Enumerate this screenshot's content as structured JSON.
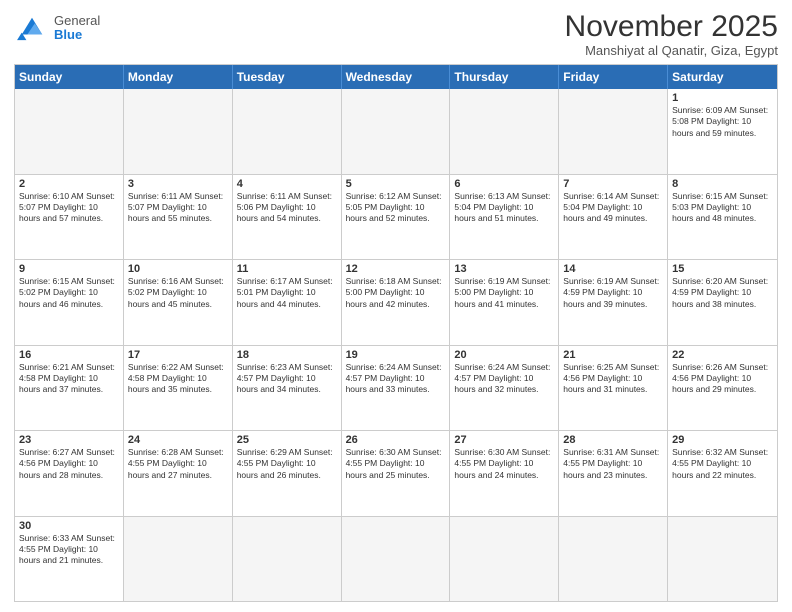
{
  "header": {
    "logo": {
      "general": "General",
      "blue": "Blue"
    },
    "month_title": "November 2025",
    "location": "Manshiyat al Qanatir, Giza, Egypt"
  },
  "weekdays": [
    "Sunday",
    "Monday",
    "Tuesday",
    "Wednesday",
    "Thursday",
    "Friday",
    "Saturday"
  ],
  "weeks": [
    [
      {
        "day": "",
        "info": ""
      },
      {
        "day": "",
        "info": ""
      },
      {
        "day": "",
        "info": ""
      },
      {
        "day": "",
        "info": ""
      },
      {
        "day": "",
        "info": ""
      },
      {
        "day": "",
        "info": ""
      },
      {
        "day": "1",
        "info": "Sunrise: 6:09 AM\nSunset: 5:08 PM\nDaylight: 10 hours and 59 minutes."
      }
    ],
    [
      {
        "day": "2",
        "info": "Sunrise: 6:10 AM\nSunset: 5:07 PM\nDaylight: 10 hours and 57 minutes."
      },
      {
        "day": "3",
        "info": "Sunrise: 6:11 AM\nSunset: 5:07 PM\nDaylight: 10 hours and 55 minutes."
      },
      {
        "day": "4",
        "info": "Sunrise: 6:11 AM\nSunset: 5:06 PM\nDaylight: 10 hours and 54 minutes."
      },
      {
        "day": "5",
        "info": "Sunrise: 6:12 AM\nSunset: 5:05 PM\nDaylight: 10 hours and 52 minutes."
      },
      {
        "day": "6",
        "info": "Sunrise: 6:13 AM\nSunset: 5:04 PM\nDaylight: 10 hours and 51 minutes."
      },
      {
        "day": "7",
        "info": "Sunrise: 6:14 AM\nSunset: 5:04 PM\nDaylight: 10 hours and 49 minutes."
      },
      {
        "day": "8",
        "info": "Sunrise: 6:15 AM\nSunset: 5:03 PM\nDaylight: 10 hours and 48 minutes."
      }
    ],
    [
      {
        "day": "9",
        "info": "Sunrise: 6:15 AM\nSunset: 5:02 PM\nDaylight: 10 hours and 46 minutes."
      },
      {
        "day": "10",
        "info": "Sunrise: 6:16 AM\nSunset: 5:02 PM\nDaylight: 10 hours and 45 minutes."
      },
      {
        "day": "11",
        "info": "Sunrise: 6:17 AM\nSunset: 5:01 PM\nDaylight: 10 hours and 44 minutes."
      },
      {
        "day": "12",
        "info": "Sunrise: 6:18 AM\nSunset: 5:00 PM\nDaylight: 10 hours and 42 minutes."
      },
      {
        "day": "13",
        "info": "Sunrise: 6:19 AM\nSunset: 5:00 PM\nDaylight: 10 hours and 41 minutes."
      },
      {
        "day": "14",
        "info": "Sunrise: 6:19 AM\nSunset: 4:59 PM\nDaylight: 10 hours and 39 minutes."
      },
      {
        "day": "15",
        "info": "Sunrise: 6:20 AM\nSunset: 4:59 PM\nDaylight: 10 hours and 38 minutes."
      }
    ],
    [
      {
        "day": "16",
        "info": "Sunrise: 6:21 AM\nSunset: 4:58 PM\nDaylight: 10 hours and 37 minutes."
      },
      {
        "day": "17",
        "info": "Sunrise: 6:22 AM\nSunset: 4:58 PM\nDaylight: 10 hours and 35 minutes."
      },
      {
        "day": "18",
        "info": "Sunrise: 6:23 AM\nSunset: 4:57 PM\nDaylight: 10 hours and 34 minutes."
      },
      {
        "day": "19",
        "info": "Sunrise: 6:24 AM\nSunset: 4:57 PM\nDaylight: 10 hours and 33 minutes."
      },
      {
        "day": "20",
        "info": "Sunrise: 6:24 AM\nSunset: 4:57 PM\nDaylight: 10 hours and 32 minutes."
      },
      {
        "day": "21",
        "info": "Sunrise: 6:25 AM\nSunset: 4:56 PM\nDaylight: 10 hours and 31 minutes."
      },
      {
        "day": "22",
        "info": "Sunrise: 6:26 AM\nSunset: 4:56 PM\nDaylight: 10 hours and 29 minutes."
      }
    ],
    [
      {
        "day": "23",
        "info": "Sunrise: 6:27 AM\nSunset: 4:56 PM\nDaylight: 10 hours and 28 minutes."
      },
      {
        "day": "24",
        "info": "Sunrise: 6:28 AM\nSunset: 4:55 PM\nDaylight: 10 hours and 27 minutes."
      },
      {
        "day": "25",
        "info": "Sunrise: 6:29 AM\nSunset: 4:55 PM\nDaylight: 10 hours and 26 minutes."
      },
      {
        "day": "26",
        "info": "Sunrise: 6:30 AM\nSunset: 4:55 PM\nDaylight: 10 hours and 25 minutes."
      },
      {
        "day": "27",
        "info": "Sunrise: 6:30 AM\nSunset: 4:55 PM\nDaylight: 10 hours and 24 minutes."
      },
      {
        "day": "28",
        "info": "Sunrise: 6:31 AM\nSunset: 4:55 PM\nDaylight: 10 hours and 23 minutes."
      },
      {
        "day": "29",
        "info": "Sunrise: 6:32 AM\nSunset: 4:55 PM\nDaylight: 10 hours and 22 minutes."
      }
    ],
    [
      {
        "day": "30",
        "info": "Sunrise: 6:33 AM\nSunset: 4:55 PM\nDaylight: 10 hours and 21 minutes."
      },
      {
        "day": "",
        "info": ""
      },
      {
        "day": "",
        "info": ""
      },
      {
        "day": "",
        "info": ""
      },
      {
        "day": "",
        "info": ""
      },
      {
        "day": "",
        "info": ""
      },
      {
        "day": "",
        "info": ""
      }
    ]
  ]
}
